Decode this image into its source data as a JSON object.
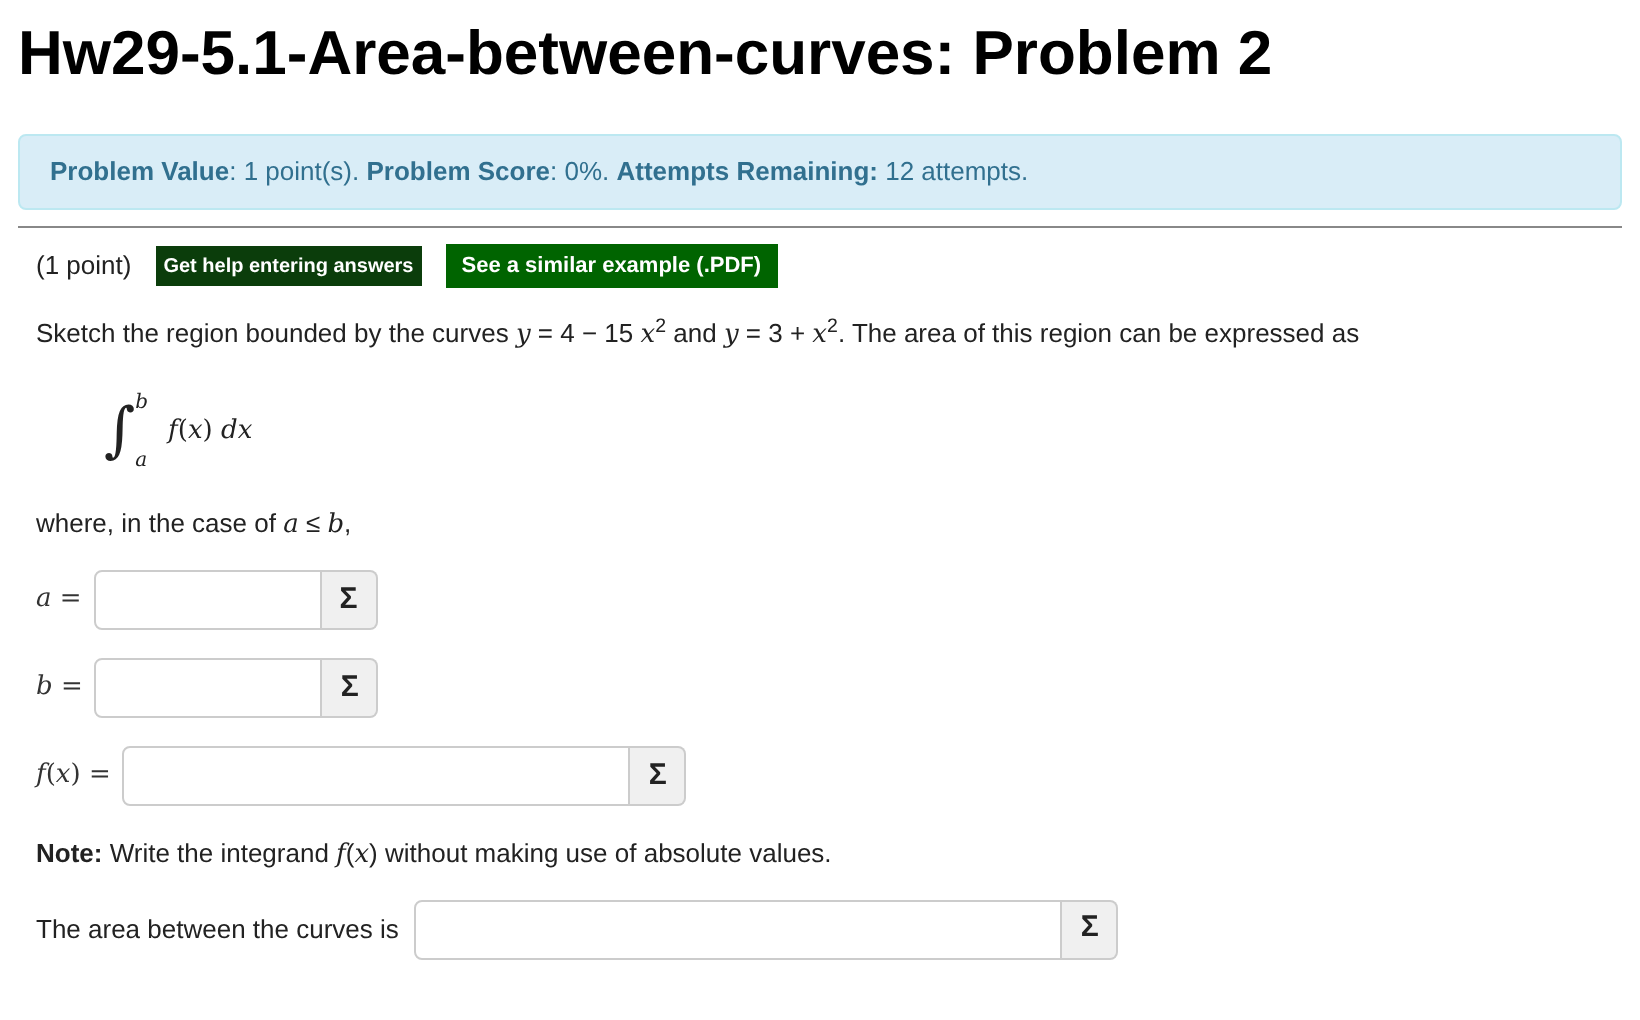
{
  "title": "Hw29-5.1-Area-between-curves: Problem 2",
  "info": "**Problem Value**: 1 point(s). **Problem Score**: 0%. **Attempts Remaining:** 12 attempts.",
  "points": "(1 point)",
  "buttons": [
    {
      "label": "Get help entering answers",
      "kind": "help"
    },
    {
      "label": "See a similar example (.PDF)",
      "kind": "example"
    }
  ],
  "statement": "Sketch the region bounded by the curves *y* = 4 − 15 *x*$^{2}$ and *y* = 3 + *x*$^{2}$. The area of this region can be expressed as",
  "integral": {
    "sign": "∫",
    "upper": "b",
    "lower": "a",
    "body": "*f*(*x*) *dx*"
  },
  "condition": "where, in the case of *a* ≤ *b*,",
  "fields": [
    {
      "label": "*a* =",
      "button": "Σ"
    },
    {
      "label": "*b* =",
      "button": "Σ"
    },
    {
      "label": "*f*(*x*) =",
      "button": "Σ"
    }
  ],
  "note": "**Note:** Write the integrand *f*(*x*) without making use of absolute values.",
  "area": {
    "label": "The area between the curves is",
    "button": "Σ"
  }
}
